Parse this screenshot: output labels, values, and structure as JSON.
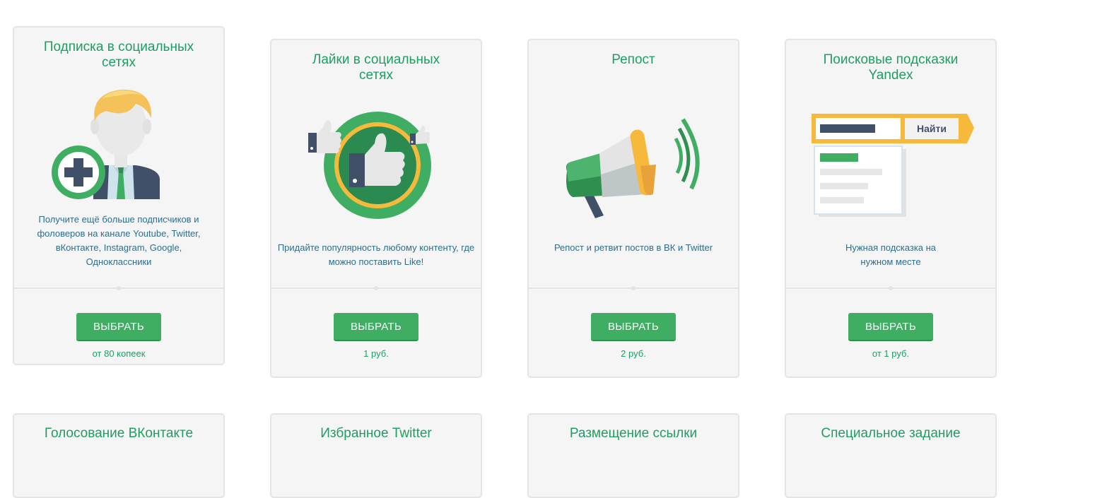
{
  "cards": [
    {
      "title": "Подписка в социальных сетях",
      "description": "Получите ещё больше подписчиков и фоловеров на канале Youtube, Twitter, вКонтакте, Instagram, Google, Одноклассники",
      "button": "ВЫБРАТЬ",
      "price": "от 80 копеек",
      "icon": "subscriber-plus-icon"
    },
    {
      "title": "Лайки в социальных сетях",
      "description": "Придайте популярность любому контенту, где можно поставить Like!",
      "button": "ВЫБРАТЬ",
      "price": "1 руб.",
      "icon": "thumbs-up-icon"
    },
    {
      "title": "Репост",
      "description": "Репост и ретвит постов в ВК и Twitter",
      "button": "ВЫБРАТЬ",
      "price": "2 руб.",
      "icon": "megaphone-icon"
    },
    {
      "title": "Поисковые подсказки Yandex",
      "description": "Нужная подсказка на нужном месте",
      "button": "ВЫБРАТЬ",
      "price": "от 1 руб.",
      "icon": "search-suggest-icon",
      "search_button_label": "Найти"
    }
  ],
  "next_row_titles": [
    "Голосование ВКонтакте",
    "Избранное Twitter",
    "Размещение ссылки",
    "Специальное задание"
  ],
  "colors": {
    "brand_green": "#1f9d63",
    "button_green": "#3fae62",
    "text_blue": "#2d6e8e",
    "card_bg": "#f5f5f5",
    "accent_yellow": "#f6b93b",
    "dark_slate": "#3f5068"
  }
}
